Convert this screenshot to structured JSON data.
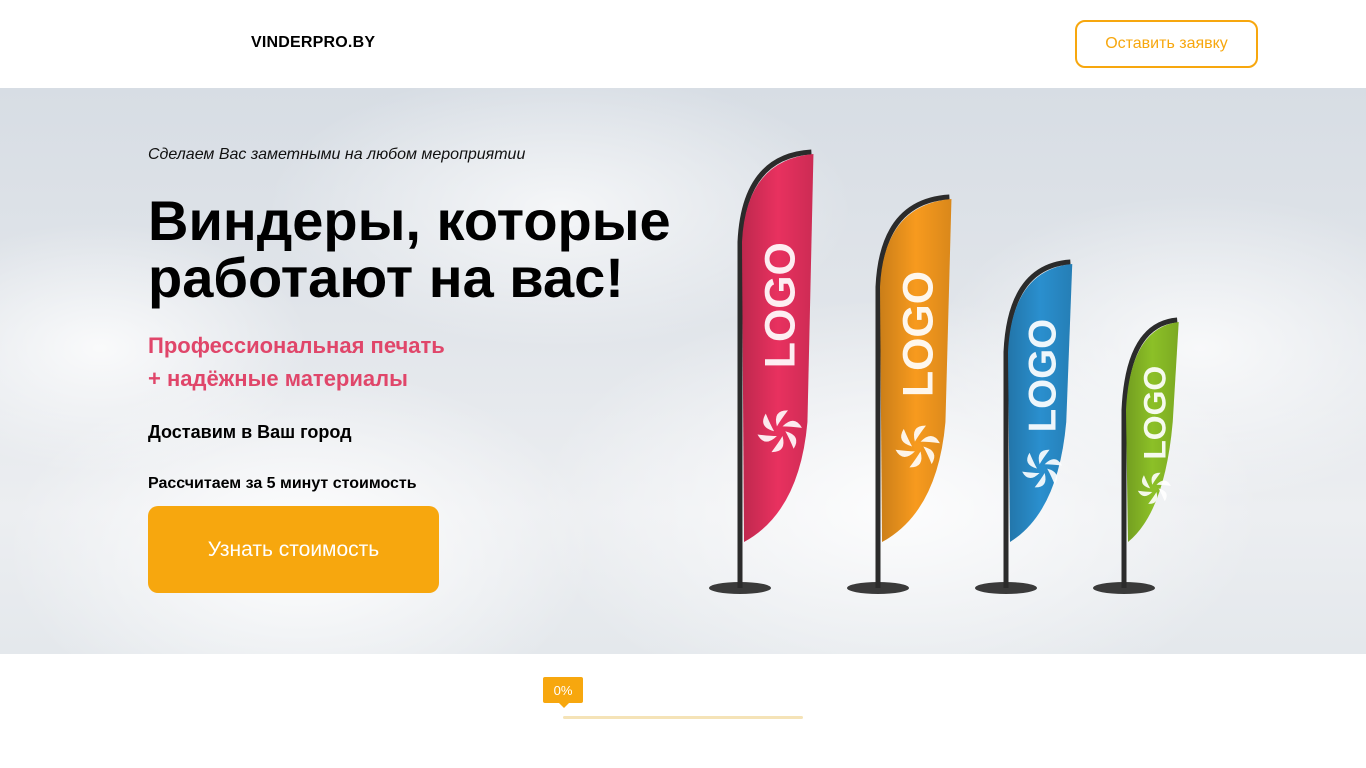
{
  "header": {
    "logo": "VINDERPRO.BY",
    "request_button": "Оставить заявку"
  },
  "hero": {
    "tagline": "Сделаем Вас заметными на любом мероприятии",
    "headline_line1": "Виндеры, которые",
    "headline_line2": "работают на вас!",
    "feature_line1": "Профессиональная печать",
    "feature_line2": "+ надёжные материалы",
    "delivery": "Доставим в Ваш город",
    "calc_note": "Рассчитаем за 5 минут стоимость",
    "price_button": "Узнать стоимость",
    "flags": [
      {
        "label": "LOGO",
        "color": "#e8315f"
      },
      {
        "label": "LOGO",
        "color": "#f79a1e"
      },
      {
        "label": "LOGO",
        "color": "#2a8fce"
      },
      {
        "label": "LOGO",
        "color": "#8cc027"
      }
    ]
  },
  "progress": {
    "label": "0%",
    "value": 0
  },
  "colors": {
    "accent": "#f7a70e",
    "pink": "#e0466a"
  }
}
